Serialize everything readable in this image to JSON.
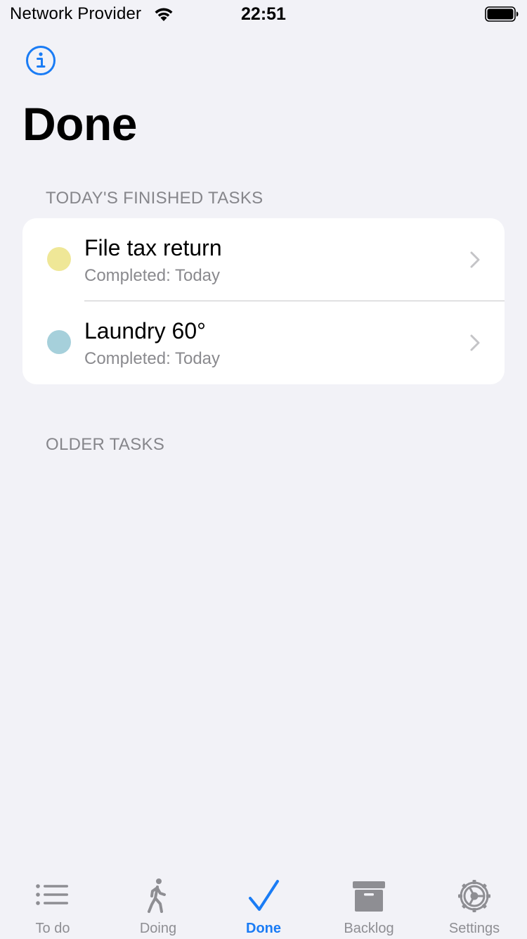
{
  "status_bar": {
    "carrier": "Network Provider",
    "time": "22:51"
  },
  "header": {
    "title": "Done"
  },
  "sections": {
    "today_header": "TODAY'S FINISHED TASKS",
    "older_header": "OLDER TASKS"
  },
  "tasks": [
    {
      "title": "File tax return",
      "subtitle": "Completed: Today",
      "color": "#EFE797"
    },
    {
      "title": "Laundry 60°",
      "subtitle": "Completed: Today",
      "color": "#A6D0DB"
    }
  ],
  "tab_bar": {
    "accent": "#1A7CF5",
    "inactive": "#8E8E93",
    "tabs": [
      {
        "label": "To do",
        "icon": "list-icon"
      },
      {
        "label": "Doing",
        "icon": "walking-figure-icon"
      },
      {
        "label": "Done",
        "icon": "checkmark-icon",
        "active": true
      },
      {
        "label": "Backlog",
        "icon": "archive-box-icon"
      },
      {
        "label": "Settings",
        "icon": "gear-icon"
      }
    ]
  }
}
